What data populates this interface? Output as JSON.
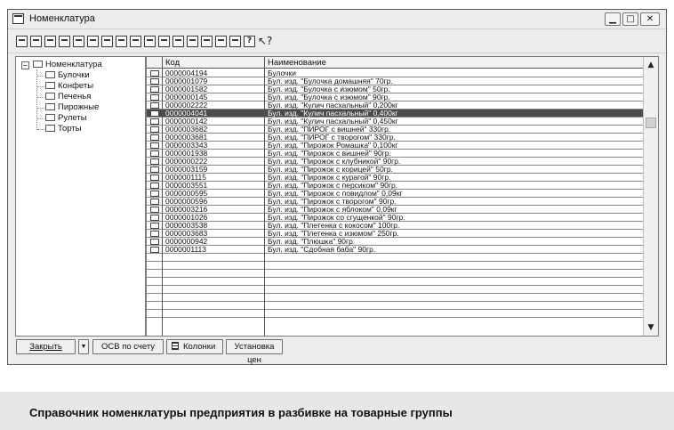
{
  "window": {
    "title": "Номенклатура",
    "min_glyph": "▁",
    "max_glyph": "□",
    "close_glyph": "✕"
  },
  "toolbar": {
    "icons": [
      "new-item-icon",
      "new-folder-icon",
      "copy-icon",
      "edit-icon",
      "print-icon",
      "delete-icon",
      "move-icon",
      "hierarchy-icon",
      "filter-icon",
      "find-icon",
      "select-icon",
      "list-icon",
      "tree-icon",
      "history-icon",
      "settings-icon",
      "view-icon",
      "help-icon",
      "context-help-icon"
    ],
    "help_glyph": "?",
    "cursor_glyph": "↖?"
  },
  "tree": {
    "root": "Номенклатура",
    "expander": "−",
    "items": [
      "Булочки",
      "Конфеты",
      "Печенья",
      "Пирожные",
      "Рулеты",
      "Торты"
    ]
  },
  "grid": {
    "columns": {
      "code": "Код",
      "name": "Наименование"
    },
    "selected_index": 5,
    "rows": [
      {
        "code": "0000004194",
        "name": "Булочки"
      },
      {
        "code": "0000001079",
        "name": "Бул. изд. \"Булочка домашняя\" 70гр."
      },
      {
        "code": "0000001582",
        "name": "Бул. изд. \"Булочка с изюмом\" 50гр."
      },
      {
        "code": "0000000145",
        "name": "Бул. изд. \"Булочка с изюмом\" 90гр."
      },
      {
        "code": "0000002222",
        "name": "Бул. изд. \"Кулич пасхальный\" 0,200кг"
      },
      {
        "code": "0000004041",
        "name": "Бул. изд. \"Кулич пасхальный\" 0,400кг"
      },
      {
        "code": "0000000142",
        "name": "Бул. изд. \"Кулич пасхальный\" 0,450кг"
      },
      {
        "code": "0000003682",
        "name": "Бул. изд. \"ПИРОГ с вишней\" 330гр."
      },
      {
        "code": "0000003681",
        "name": "Бул. изд. \"ПИРОГ с творогом\" 330гр."
      },
      {
        "code": "0000003343",
        "name": "Бул. изд. \"Пирожок Ромашка\" 0,100кг"
      },
      {
        "code": "0000001938",
        "name": "Бул. изд. \"Пирожок с вишней\" 90гр."
      },
      {
        "code": "0000000222",
        "name": "Бул. изд. \"Пирожок с клубникой\" 90гр."
      },
      {
        "code": "0000003159",
        "name": "Бул. изд. \"Пирожок с корицей\" 50гр."
      },
      {
        "code": "0000001115",
        "name": "Бул. изд. \"Пирожок с курагой\" 90гр."
      },
      {
        "code": "0000003551",
        "name": "Бул. изд. \"Пирожок с персиком\" 90гр."
      },
      {
        "code": "0000000595",
        "name": "Бул. изд. \"Пирожок с повидлом\" 0,09кг"
      },
      {
        "code": "0000000596",
        "name": "Бул. изд. \"Пирожок с творогом\" 90гр."
      },
      {
        "code": "0000003216",
        "name": "Бул. изд. \"Пирожок с яблоком\" 0,09кг"
      },
      {
        "code": "0000001026",
        "name": "Бул. изд. \"Пирожок со сгущенкой\" 90гр."
      },
      {
        "code": "0000003538",
        "name": "Бул. изд. \"Плетенка с кокосом\" 100гр."
      },
      {
        "code": "0000003683",
        "name": "Бул. изд. \"Плетенка с изюмом\" 250гр."
      },
      {
        "code": "0000000942",
        "name": "Бул. изд. \"Плюшка\" 90гр."
      },
      {
        "code": "0000001113",
        "name": "Бул. изд. \"Сдобная баба\" 90гр."
      }
    ],
    "scroll_up": "▲",
    "scroll_down": "▼"
  },
  "buttons": {
    "close": "Закрыть",
    "dropdown": "▼",
    "osv": "ОСВ по счету",
    "columns": "Колонки",
    "set_prices": "Установка цен"
  },
  "caption": "Справочник номенклатуры предприятия в разбивке на товарные группы",
  "colors": {
    "selection": "#4a4a4a",
    "window_bg": "#ececec",
    "caption_bg": "#e7e7e7"
  }
}
